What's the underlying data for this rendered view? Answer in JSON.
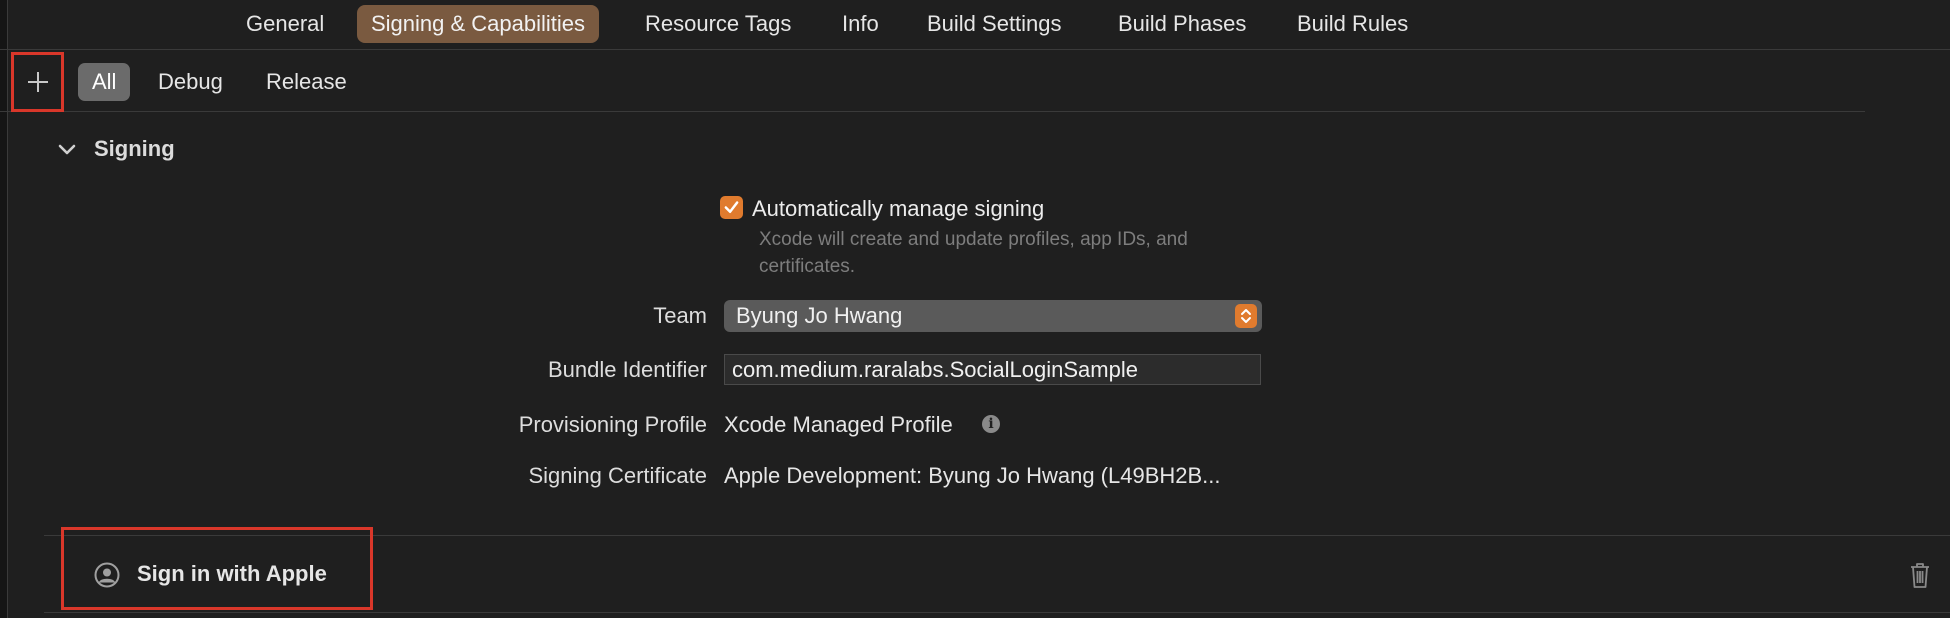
{
  "tabs": [
    {
      "label": "General",
      "active": false
    },
    {
      "label": "Signing & Capabilities",
      "active": true
    },
    {
      "label": "Resource Tags",
      "active": false
    },
    {
      "label": "Info",
      "active": false
    },
    {
      "label": "Build Settings",
      "active": false
    },
    {
      "label": "Build Phases",
      "active": false
    },
    {
      "label": "Build Rules",
      "active": false
    }
  ],
  "config": {
    "add_icon": "plus-icon",
    "segments": [
      {
        "label": "All",
        "selected": true
      },
      {
        "label": "Debug",
        "selected": false
      },
      {
        "label": "Release",
        "selected": false
      }
    ]
  },
  "signing": {
    "section_title": "Signing",
    "auto_manage": {
      "checked": true,
      "label": "Automatically manage signing",
      "helper": "Xcode will create and update profiles, app IDs, and certificates."
    },
    "team": {
      "label": "Team",
      "value": "Byung Jo Hwang"
    },
    "bundle": {
      "label": "Bundle Identifier",
      "value": "com.medium.raralabs.SocialLoginSample"
    },
    "profile": {
      "label": "Provisioning Profile",
      "value": "Xcode Managed Profile"
    },
    "certificate": {
      "label": "Signing Certificate",
      "value": "Apple Development: Byung Jo Hwang (L49BH2B..."
    }
  },
  "capability": {
    "title": "Sign in with Apple",
    "icon": "person-circle-icon",
    "delete_icon": "trash-icon"
  },
  "colors": {
    "accent": "#e07b2e",
    "active_tab": "#7a5a40",
    "highlight": "#d9372a",
    "background": "#1f1f1f"
  }
}
